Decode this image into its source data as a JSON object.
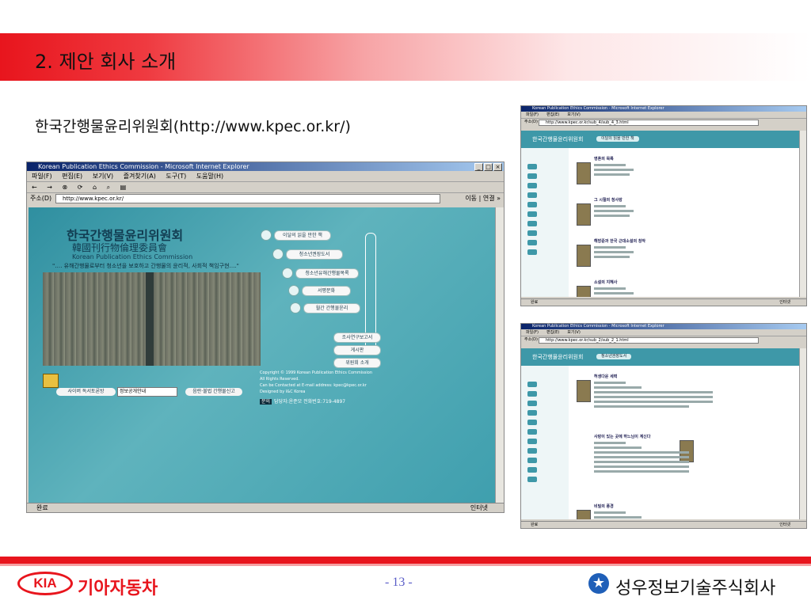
{
  "slide": {
    "title": "2. 제안 회사 소개",
    "subtitle": "한국간행물윤리위원회(http://www.kpec.or.kr/)",
    "page_number": "- 13 -",
    "footer_left_brand": "기아자동차",
    "footer_left_logo": "KIA",
    "footer_right_company": "성우정보기술주식회사"
  },
  "main_window": {
    "title": "Korean Publication Ethics Commission - Microsoft Internet Explorer",
    "menu": [
      "파일(F)",
      "편집(E)",
      "보기(V)",
      "즐겨찾기(A)",
      "도구(T)",
      "도움말(H)"
    ],
    "address_label": "주소(D)",
    "address_value": "http://www.kpec.or.kr/",
    "go_label": "이동",
    "links_label": "연결 »",
    "status_left": "완료",
    "status_right": "인터넷",
    "site": {
      "logo": "한국간행물윤리위원회",
      "hanja": "韓國刊行物倫理委員會",
      "english": "Korean Publication Ethics Commission",
      "slogan": "\"…. 유해간행물로부터 청소년을 보호하고 간행물의 윤리적, 사회적 책임구현….\"",
      "nav": [
        "이달의 읽을 만한 책",
        "청소년권장도서",
        "청소년유해간행물목록",
        "서평문화",
        "월간 간행물윤리"
      ],
      "side_nav": [
        "조사연구보고서",
        "게시판",
        "위원회 소개"
      ],
      "copyright": [
        "Copyright © 1999 Korean Publication Ethics Commission",
        "All Rights Reserved.",
        "Can be Contacted at E-mail address: kpec@kpec.or.kr",
        "Designed by I&C Korea"
      ],
      "contact_tag": "문의",
      "contact": "담당자:윤준모  전화번호:719-4897",
      "bottom_btn1": "사이버 독서토론방",
      "select_value": "정보공개안내",
      "bottom_btn2": "음란·불법 간행물신고"
    }
  },
  "right_window_1": {
    "title": "Korean Publication Ethics Commission - Microsoft Internet Explorer",
    "address_value": "http://www.kpec.or.kr/sub_4/sub_4_3.html",
    "status_left": "완료",
    "status_right": "인터넷",
    "items": [
      "영혼의 목록",
      "그 시절의 청사랑",
      "해방준과 한국 근대소설의 창작",
      "소설의 지혜사"
    ]
  },
  "right_window_2": {
    "title": "Korean Publication Ethics Commission - Microsoft Internet Explorer",
    "address_value": "http://www.kpec.or.kr/sub_2/sub_2_1.html",
    "status_left": "완료",
    "status_right": "인터넷",
    "items": [
      "허생다운 세력",
      "사랑이 있는 곳에 하느님이 계신다",
      "비밀의 풍경"
    ]
  }
}
